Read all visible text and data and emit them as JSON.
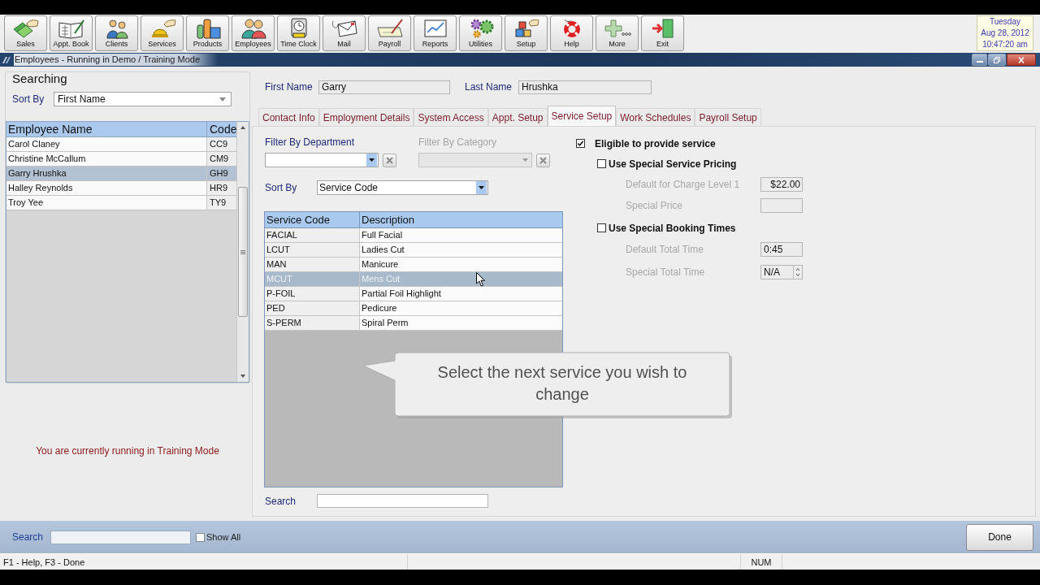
{
  "toolbar": {
    "buttons": [
      {
        "label": "Sales",
        "kind": "cash"
      },
      {
        "label": "Appt. Book",
        "kind": "book"
      },
      {
        "label": "Clients",
        "kind": "clients"
      },
      {
        "label": "Services",
        "kind": "bell"
      },
      {
        "label": "Products",
        "kind": "bottles"
      },
      {
        "label": "Employees",
        "kind": "staff"
      },
      {
        "label": "Time Clock",
        "kind": "clock"
      },
      {
        "label": "Mail",
        "kind": "envelope"
      },
      {
        "label": "Payroll",
        "kind": "cheque"
      },
      {
        "label": "Reports",
        "kind": "chart"
      },
      {
        "label": "Utilities",
        "kind": "gears"
      },
      {
        "label": "Setup",
        "kind": "boxes"
      },
      {
        "label": "Help",
        "kind": "lifebuoy"
      },
      {
        "label": "More",
        "kind": "plus"
      },
      {
        "label": "Exit",
        "kind": "door"
      }
    ]
  },
  "date_panel": {
    "day": "Tuesday",
    "date": "Aug 28, 2012",
    "time": "10:47:20 am"
  },
  "window": {
    "title": "Employees - Running in Demo / Training Mode"
  },
  "searching": {
    "title": "Searching",
    "sort_by": {
      "label": "Sort By",
      "value": "First Name"
    },
    "employee_list": {
      "columns": [
        "Employee Name",
        "Code"
      ],
      "rows": [
        {
          "name": "Carol Claney",
          "code": "CC9",
          "selected": false
        },
        {
          "name": "Christine McCallum",
          "code": "CM9",
          "selected": false
        },
        {
          "name": "Garry Hrushka",
          "code": "GH9",
          "selected": true
        },
        {
          "name": "Halley Reynolds",
          "code": "HR9",
          "selected": false
        },
        {
          "name": "Troy Yee",
          "code": "TY9",
          "selected": false
        }
      ]
    },
    "notice": "You are currently running in Training Mode"
  },
  "employee": {
    "first_name": {
      "label": "First Name",
      "value": "Garry"
    },
    "last_name": {
      "label": "Last Name",
      "value": "Hrushka"
    }
  },
  "tabs": [
    {
      "label": "Contact Info",
      "selected": false
    },
    {
      "label": "Employment Details",
      "selected": false
    },
    {
      "label": "System Access",
      "selected": false
    },
    {
      "label": "Appt. Setup",
      "selected": false
    },
    {
      "label": "Service Setup",
      "selected": true
    },
    {
      "label": "Work Schedules",
      "selected": false
    },
    {
      "label": "Payroll Setup",
      "selected": false
    }
  ],
  "service_setup": {
    "filter_department": {
      "label": "Filter By Department",
      "disabled": false
    },
    "filter_category": {
      "label": "Filter By Category",
      "disabled": true
    },
    "sort_by": {
      "label": "Sort By",
      "value": "Service Code"
    },
    "services": {
      "columns": [
        "Service Code",
        "Description"
      ],
      "rows": [
        {
          "code": "FACIAL",
          "description": "Full Facial",
          "selected": false
        },
        {
          "code": "LCUT",
          "description": "Ladies Cut",
          "selected": false
        },
        {
          "code": "MAN",
          "description": "Manicure",
          "selected": false
        },
        {
          "code": "MCUT",
          "description": "Mens Cut",
          "selected": true
        },
        {
          "code": "P-FOIL",
          "description": "Partial Foil Highlight",
          "selected": false
        },
        {
          "code": "PED",
          "description": "Pedicure",
          "selected": false
        },
        {
          "code": "S-PERM",
          "description": "Spiral Perm",
          "selected": false
        }
      ]
    },
    "search": {
      "label": "Search"
    },
    "eligible": {
      "label": "Eligible to provide service",
      "checked": true
    },
    "special_pricing": {
      "label": "Use Special Service Pricing",
      "checked": false,
      "fields": [
        {
          "label": "Default for Charge Level 1",
          "value": "$22.00",
          "kind": "text"
        },
        {
          "label": "Special Price",
          "kind": "text"
        }
      ]
    },
    "special_booking": {
      "label": "Use Special Booking Times",
      "checked": false,
      "fields": [
        {
          "label": "Default Total Time",
          "value": "0:45",
          "kind": "text"
        },
        {
          "label": "Special Total Time",
          "value": "N/A",
          "kind": "spinner"
        }
      ]
    }
  },
  "callout": {
    "text": "Select the next service you wish to change"
  },
  "bottom_bar": {
    "search_label": "Search",
    "show_all": {
      "label": "Show All",
      "checked": false
    },
    "done": "Done"
  },
  "status_bar": {
    "help": "F1 - Help, F3 - Done",
    "num": "NUM"
  }
}
